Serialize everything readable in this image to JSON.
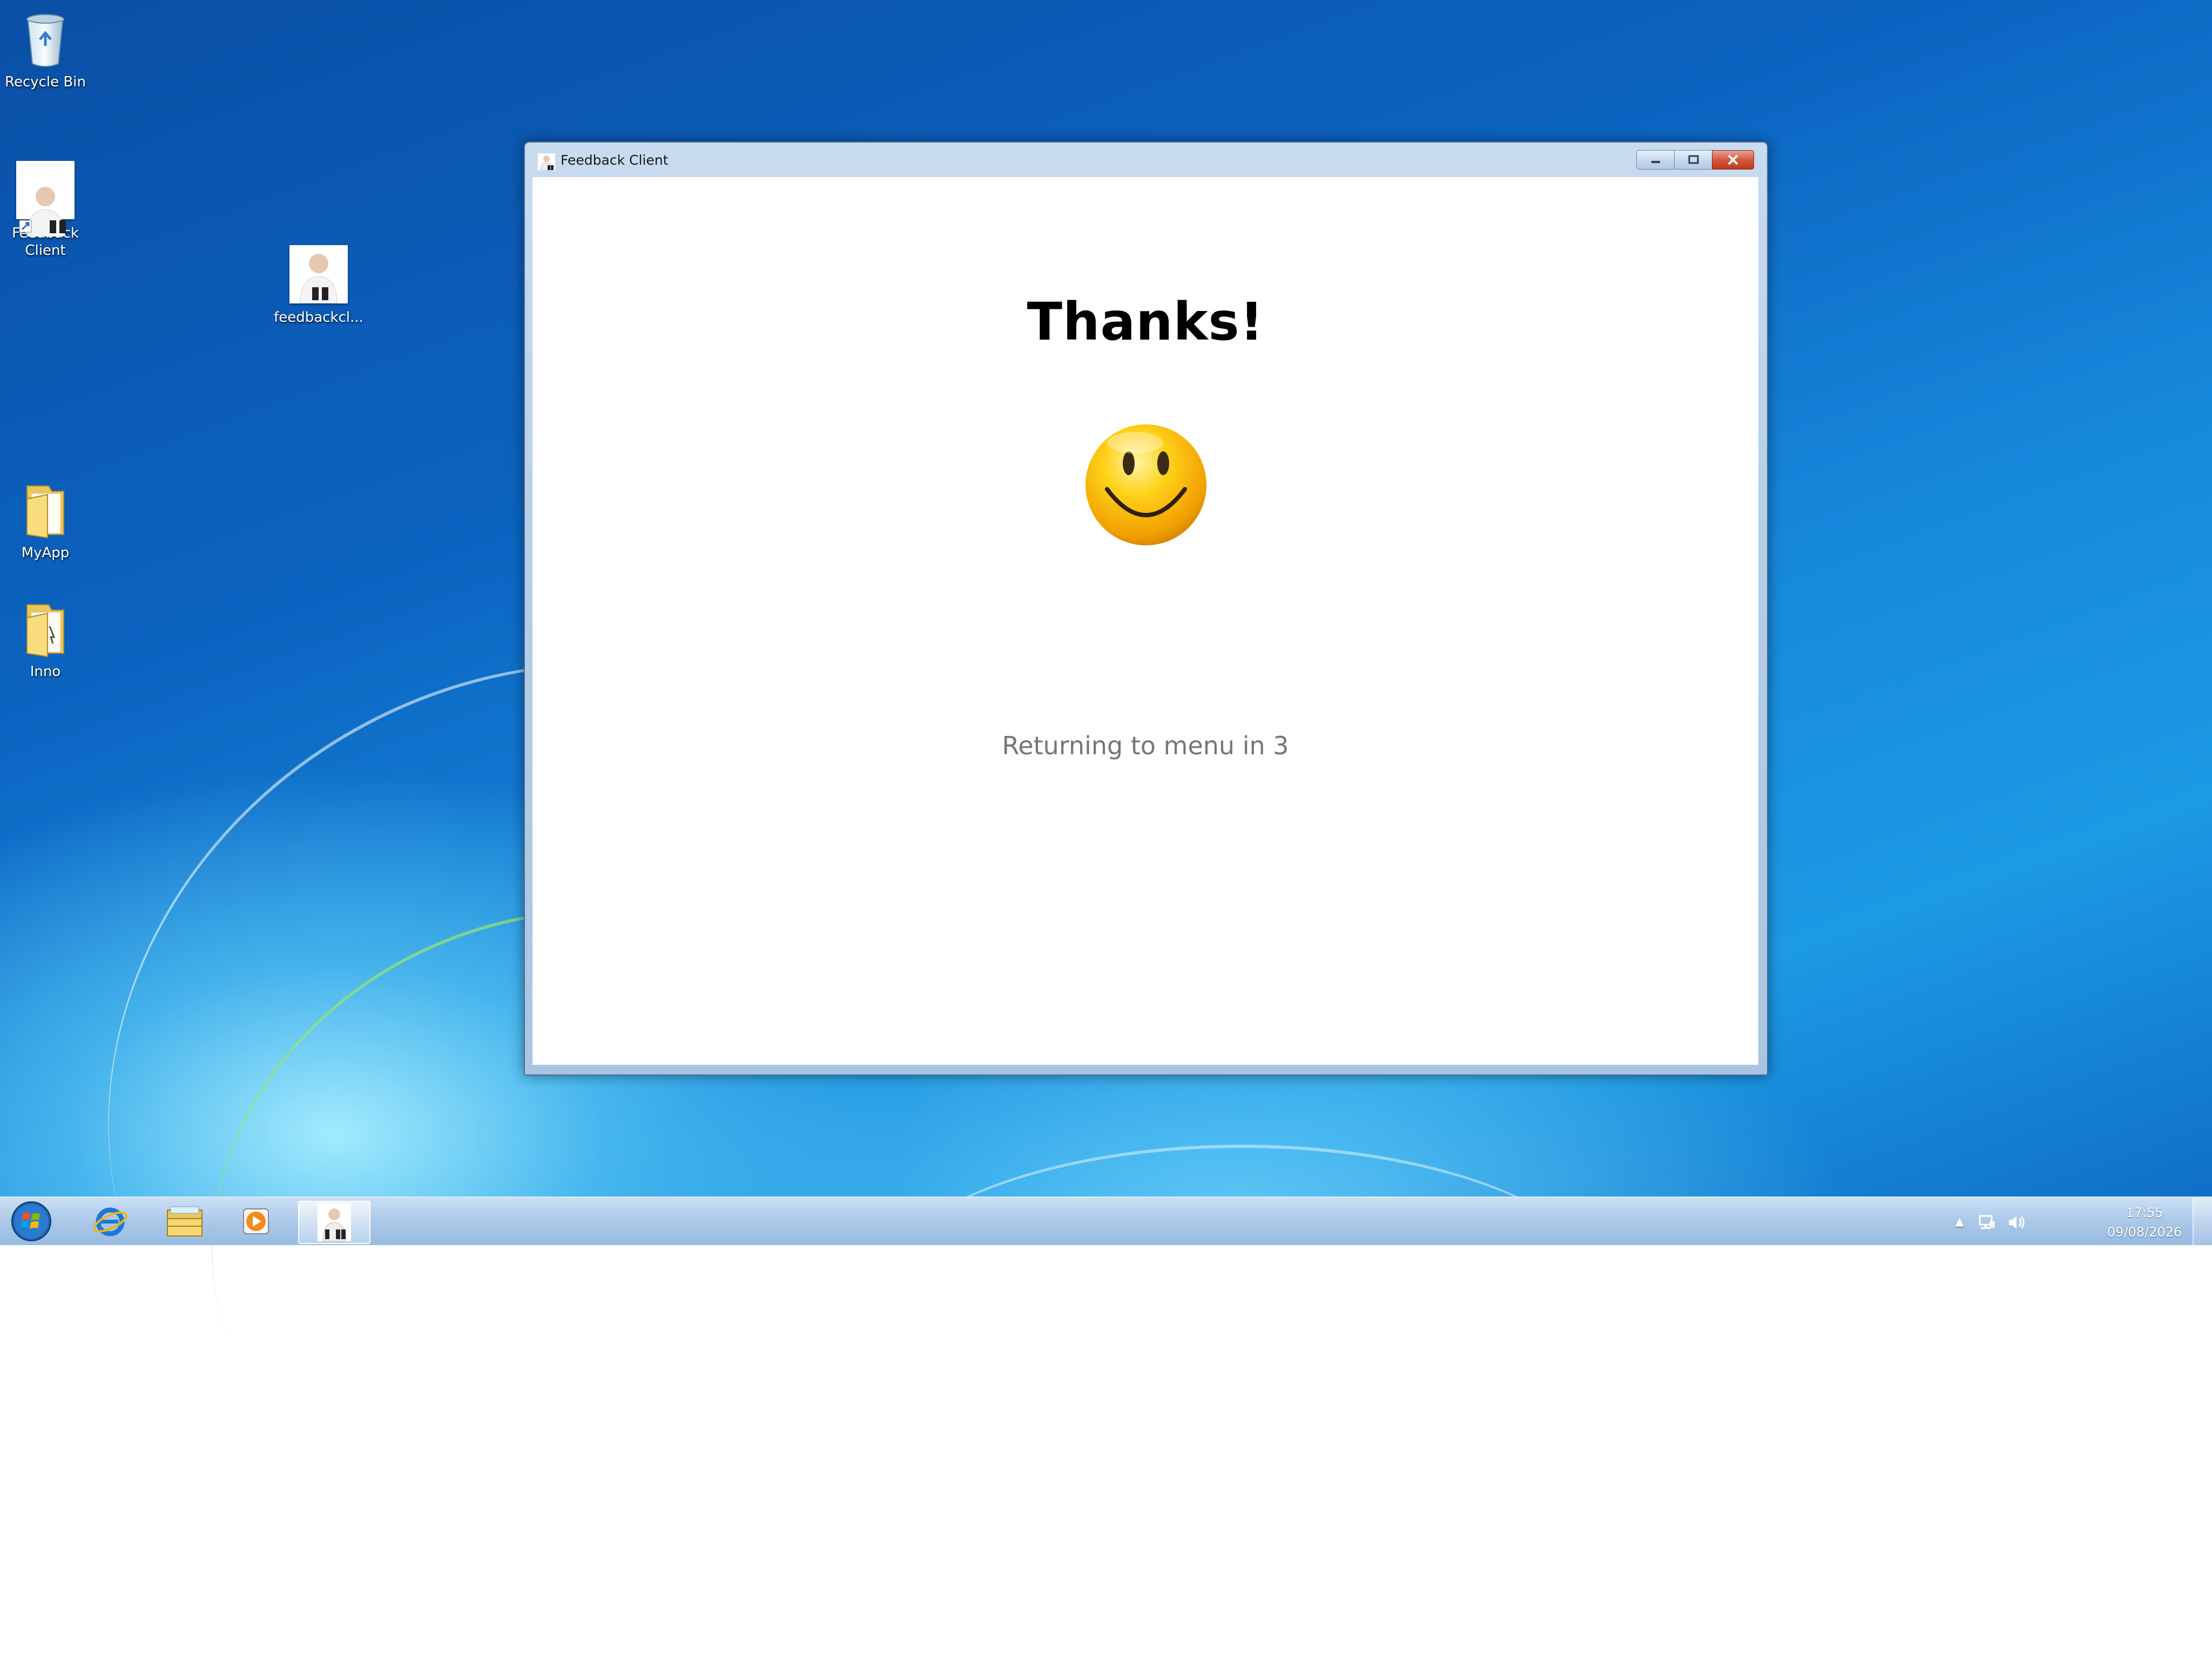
{
  "desktop": {
    "icons": [
      {
        "label": "Recycle Bin",
        "icon": "recycle-bin-icon"
      },
      {
        "label": "Feedback\nClient",
        "icon": "feedback-client-shortcut-icon"
      },
      {
        "label": "feedbackcl...",
        "icon": "feedback-client-exe-icon"
      },
      {
        "label": "MyApp",
        "icon": "folder-icon"
      },
      {
        "label": "Inno",
        "icon": "folder-icon"
      }
    ]
  },
  "window": {
    "title": "Feedback Client",
    "icon": "feedback-client-icon",
    "controls": {
      "minimize": "minimize-icon",
      "maximize": "maximize-icon",
      "close": "close-icon"
    },
    "heading": "Thanks!",
    "emoji": "smiley-face-icon",
    "countdown_text": "Returning to menu in 3"
  },
  "taskbar": {
    "pinned": [
      {
        "name": "start-button",
        "icon": "windows-logo-icon"
      },
      {
        "name": "internet-explorer",
        "icon": "internet-explorer-icon"
      },
      {
        "name": "windows-explorer",
        "icon": "folder-library-icon"
      },
      {
        "name": "media-player",
        "icon": "media-player-icon"
      },
      {
        "name": "feedback-client",
        "icon": "feedback-client-icon",
        "active": true
      }
    ],
    "tray": {
      "icons": [
        "show-hidden-icons-arrow",
        "network-icon",
        "volume-icon"
      ],
      "time": "17:55",
      "date": "09/08/2026"
    }
  },
  "colors": {
    "desktop_blue": "#0b63c0",
    "close_red": "#c1391f",
    "countdown_gray": "#767676",
    "smiley_yellow": "#f7b500"
  }
}
